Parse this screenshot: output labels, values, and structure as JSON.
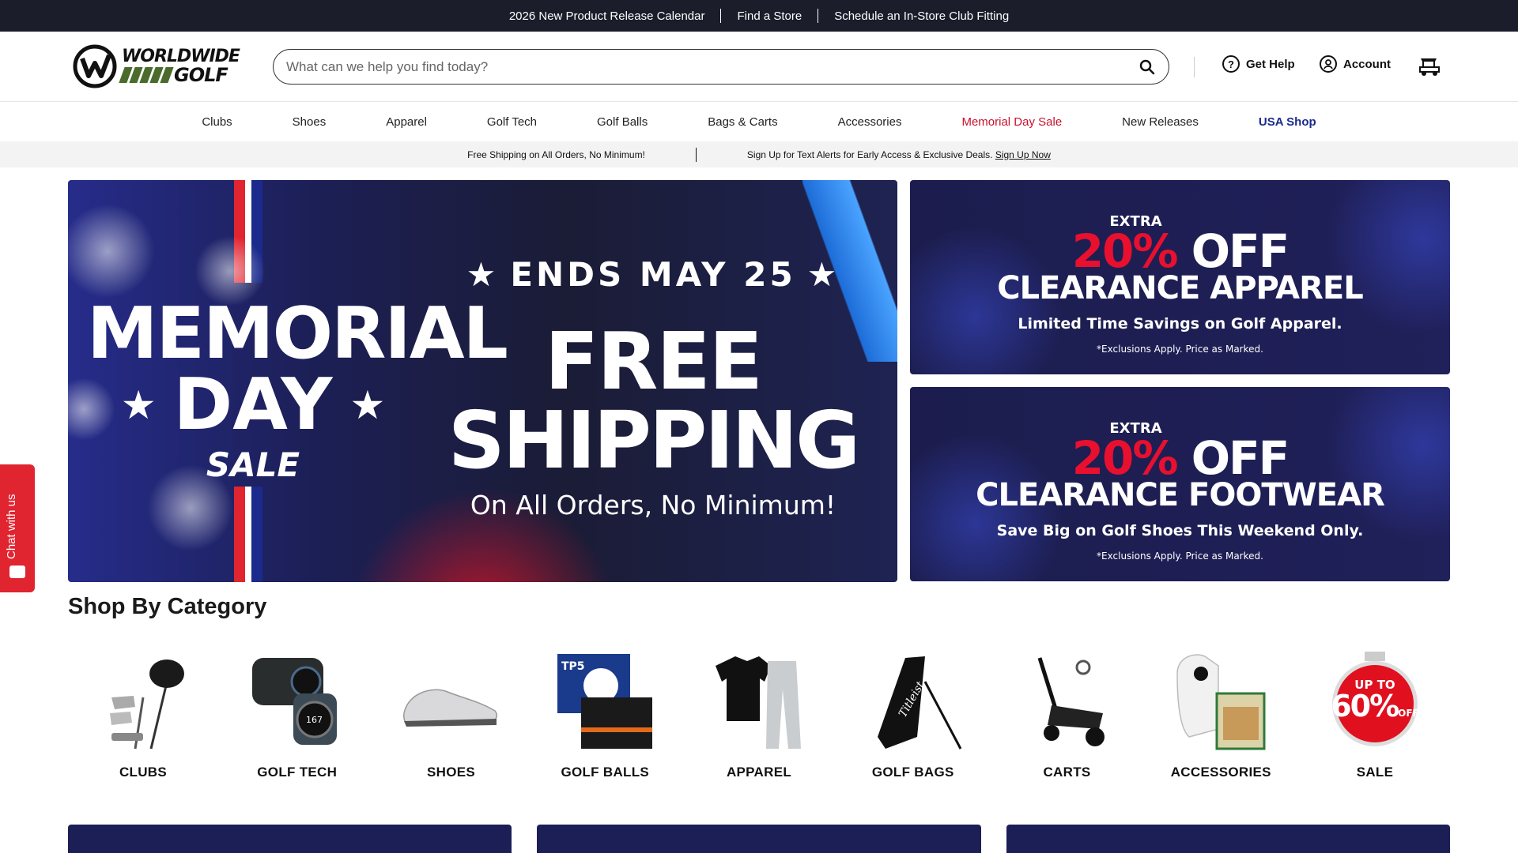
{
  "topbar": {
    "links": [
      "2026 New Product Release Calendar",
      "Find a Store",
      "Schedule an In-Store Club Fitting"
    ]
  },
  "logo": {
    "line1": "WORLDWIDE",
    "line2": "GOLF"
  },
  "search": {
    "placeholder": "What can we help you find today?",
    "value": ""
  },
  "header": {
    "help_label": "Get Help",
    "account_label": "Account"
  },
  "nav": {
    "items": [
      "Clubs",
      "Shoes",
      "Apparel",
      "Golf Tech",
      "Golf Balls",
      "Bags & Carts",
      "Accessories",
      "Memorial Day Sale",
      "New Releases",
      "USA Shop"
    ]
  },
  "promo": {
    "left": "Free Shipping on All Orders, No Minimum!",
    "right": "Sign Up for Text Alerts for Early Access & Exclusive Deals.",
    "right_link": "Sign Up Now"
  },
  "hero": {
    "line1": "MEMORIAL",
    "line2": "DAY",
    "line3": "SALE",
    "ends": "ENDS MAY 25",
    "free": "FREE",
    "shipping": "SHIPPING",
    "sub": "On All Orders, No Minimum!"
  },
  "side_banners": [
    {
      "extra": "EXTRA",
      "pct": "20%",
      "off": "OFF",
      "head": "CLEARANCE APPAREL",
      "sub": "Limited Time Savings on Golf Apparel.",
      "note": "*Exclusions Apply. Price as Marked."
    },
    {
      "extra": "EXTRA",
      "pct": "20%",
      "off": "OFF",
      "head": "CLEARANCE FOOTWEAR",
      "sub": "Save Big on Golf Shoes This Weekend Only.",
      "note": "*Exclusions Apply. Price as Marked."
    }
  ],
  "categories": {
    "title": "Shop By Category",
    "items": [
      "CLUBS",
      "GOLF TECH",
      "SHOES",
      "GOLF BALLS",
      "APPAREL",
      "GOLF BAGS",
      "CARTS",
      "ACCESSORIES",
      "SALE"
    ],
    "sale_badge": {
      "line1": "UP TO",
      "line2": "60%",
      "line3": "OFF"
    }
  },
  "chat": {
    "label": "Chat with us"
  },
  "colors": {
    "sale_red": "#c8102e",
    "usa_blue": "#1b2a8c",
    "navy": "#1c1f55",
    "topbar": "#1b1d2b"
  }
}
